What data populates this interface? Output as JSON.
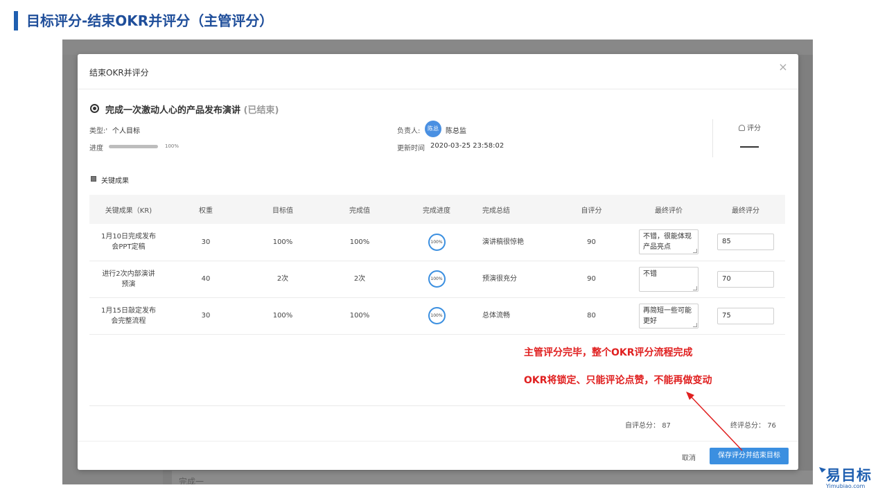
{
  "slide": {
    "title": "目标评分-结束OKR并评分（主管评分）"
  },
  "background": {
    "fragment": "完成一"
  },
  "modal": {
    "title": "结束OKR并评分",
    "close_glyph": "×",
    "objective": {
      "title": "完成一次激动人心的产品发布演讲",
      "status": "(已结束)"
    },
    "type_label": "类型:'",
    "type_value": "个人目标",
    "progress_label": "进度",
    "progress_value": "100%",
    "progress_fraction": 1.0,
    "owner_label": "负责人:",
    "owner_avatar": "陈总",
    "owner_name": "陈总监",
    "updated_label": "更新时间",
    "updated_value": "2020-03-25 23:58:02",
    "score_label": "评分",
    "kr_section_title": "关键成果",
    "table": {
      "headers": [
        "关键成果（KR)",
        "权重",
        "目标值",
        "完成值",
        "完成进度",
        "完成总结",
        "自评分",
        "最终评价",
        "最终评分"
      ],
      "rows": [
        {
          "kr_line1": "1月10日完成发布",
          "kr_line2": "会PPT定稿",
          "weight": "30",
          "target": "100%",
          "done": "100%",
          "progress": "100%",
          "summary": "演讲稿很惊艳",
          "self_score": "90",
          "eval_line1": "不错，很能体现",
          "eval_line2": "产品亮点",
          "final_score": "85"
        },
        {
          "kr_line1": "进行2次内部演讲",
          "kr_line2": "预演",
          "weight": "40",
          "target": "2次",
          "done": "2次",
          "progress": "100%",
          "summary": "预演很充分",
          "self_score": "90",
          "eval_line1": "不错",
          "eval_line2": "",
          "final_score": "70"
        },
        {
          "kr_line1": "1月15日敲定发布",
          "kr_line2": "会完整流程",
          "weight": "30",
          "target": "100%",
          "done": "100%",
          "progress": "100%",
          "summary": "总体流畅",
          "self_score": "80",
          "eval_line1": "再简短一些可能",
          "eval_line2": "更好",
          "final_score": "75"
        }
      ]
    },
    "self_total_label": "自评总分：",
    "self_total_value": "87",
    "final_total_label": "终评总分：",
    "final_total_value": "76",
    "cancel_label": "取消",
    "save_label": "保存评分并结束目标"
  },
  "annotations": {
    "line1": "主管评分完毕，整个OKR评分流程完成",
    "line2": "OKR将锁定、只能评论点赞，不能再做变动",
    "color": "#e02020"
  },
  "logo": {
    "text": "易目标",
    "url": "Yimubiao.com"
  },
  "colors": {
    "accent": "#3b8fe0",
    "title_blue": "#1f4e9a"
  }
}
